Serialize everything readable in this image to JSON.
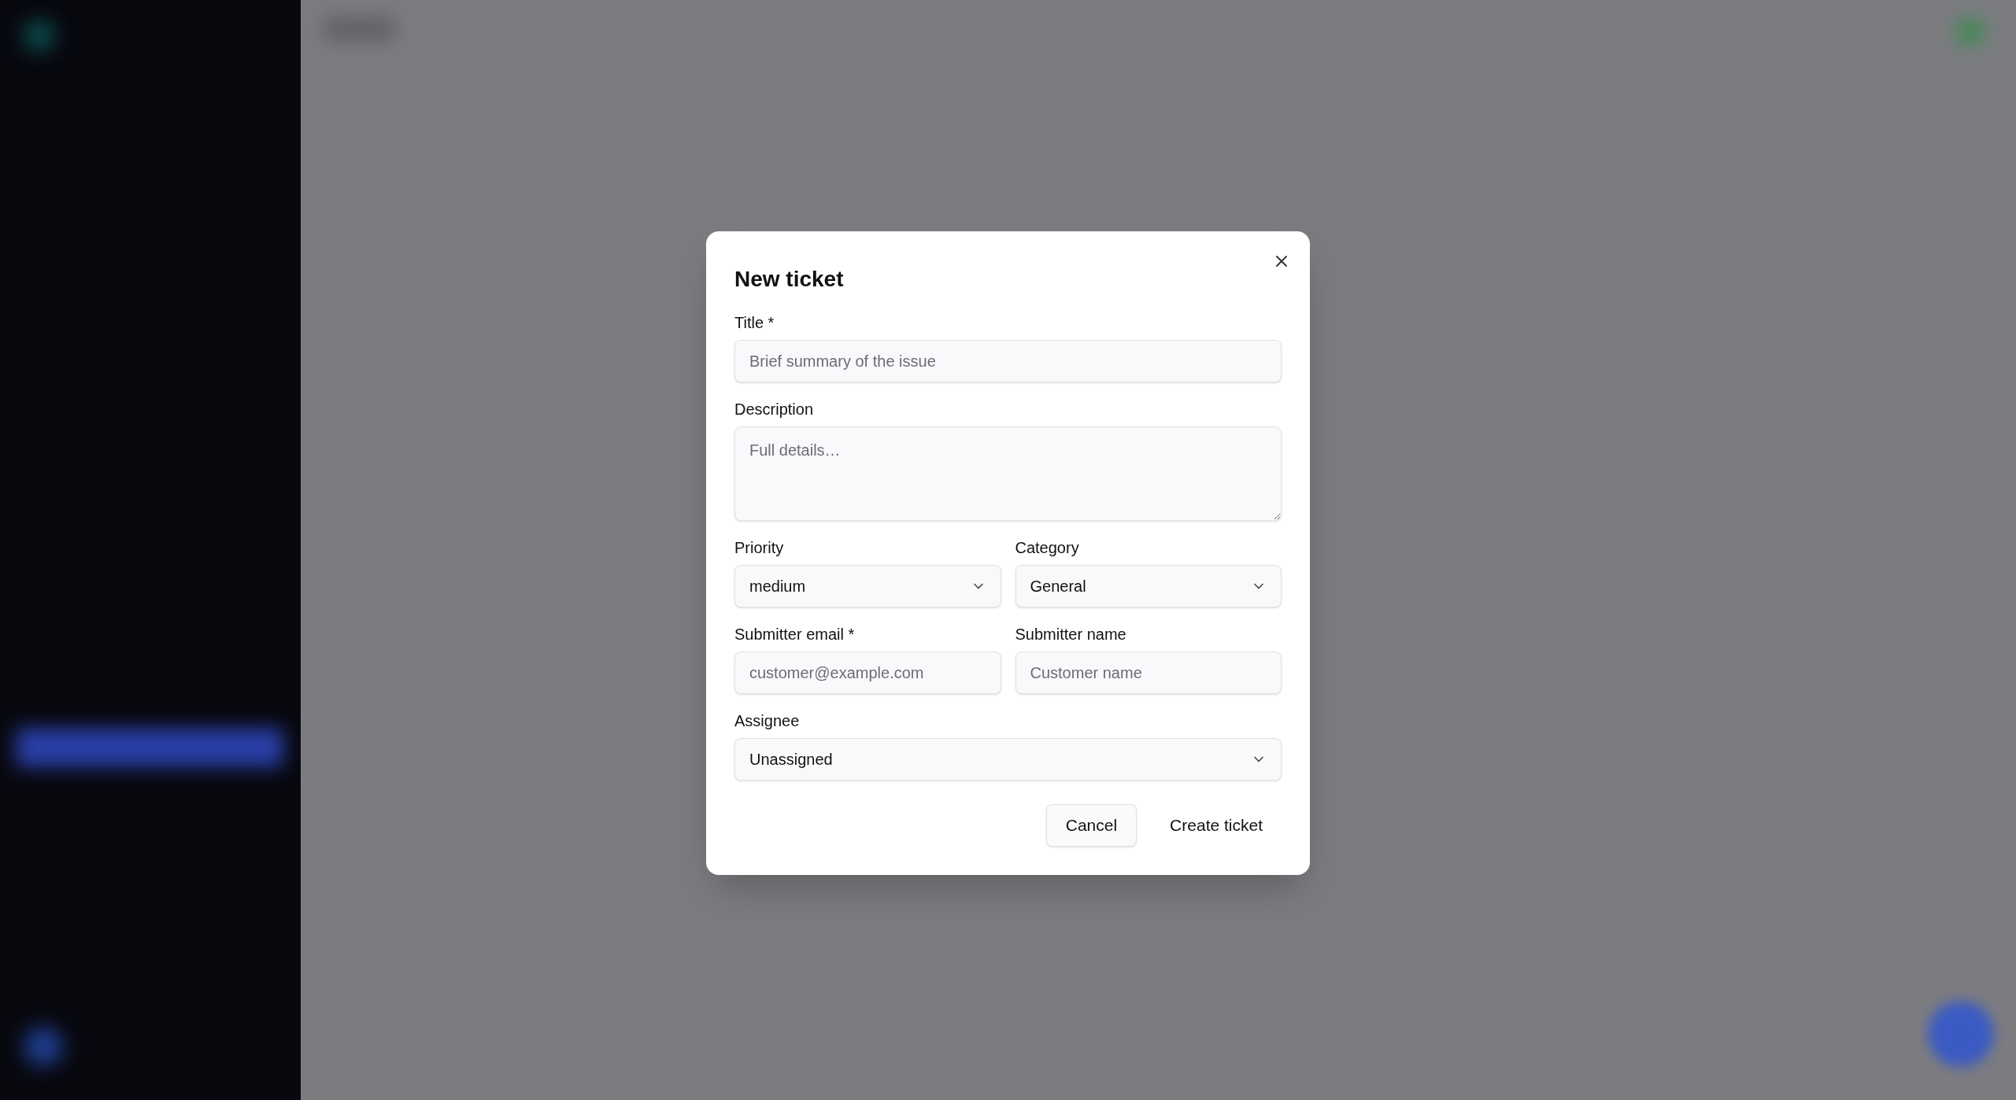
{
  "dialog": {
    "title": "New ticket",
    "rows": [
      [
        {
          "kind": "text",
          "label": "Title *",
          "placeholder": "Brief summary of the issue"
        }
      ],
      [
        {
          "kind": "textarea",
          "label": "Description",
          "placeholder": "Full details…"
        }
      ],
      [
        {
          "kind": "select",
          "label": "Priority",
          "value": "medium"
        },
        {
          "kind": "select",
          "label": "Category",
          "value": "General"
        }
      ],
      [
        {
          "kind": "text",
          "label": "Submitter email *",
          "placeholder": "customer@example.com"
        },
        {
          "kind": "text",
          "label": "Submitter name",
          "placeholder": "Customer name"
        }
      ],
      [
        {
          "kind": "select",
          "label": "Assignee",
          "value": "Unassigned"
        }
      ]
    ],
    "buttons": [
      {
        "label": "Cancel",
        "kind": "outline"
      },
      {
        "label": "Create ticket",
        "kind": "ghost"
      }
    ]
  }
}
